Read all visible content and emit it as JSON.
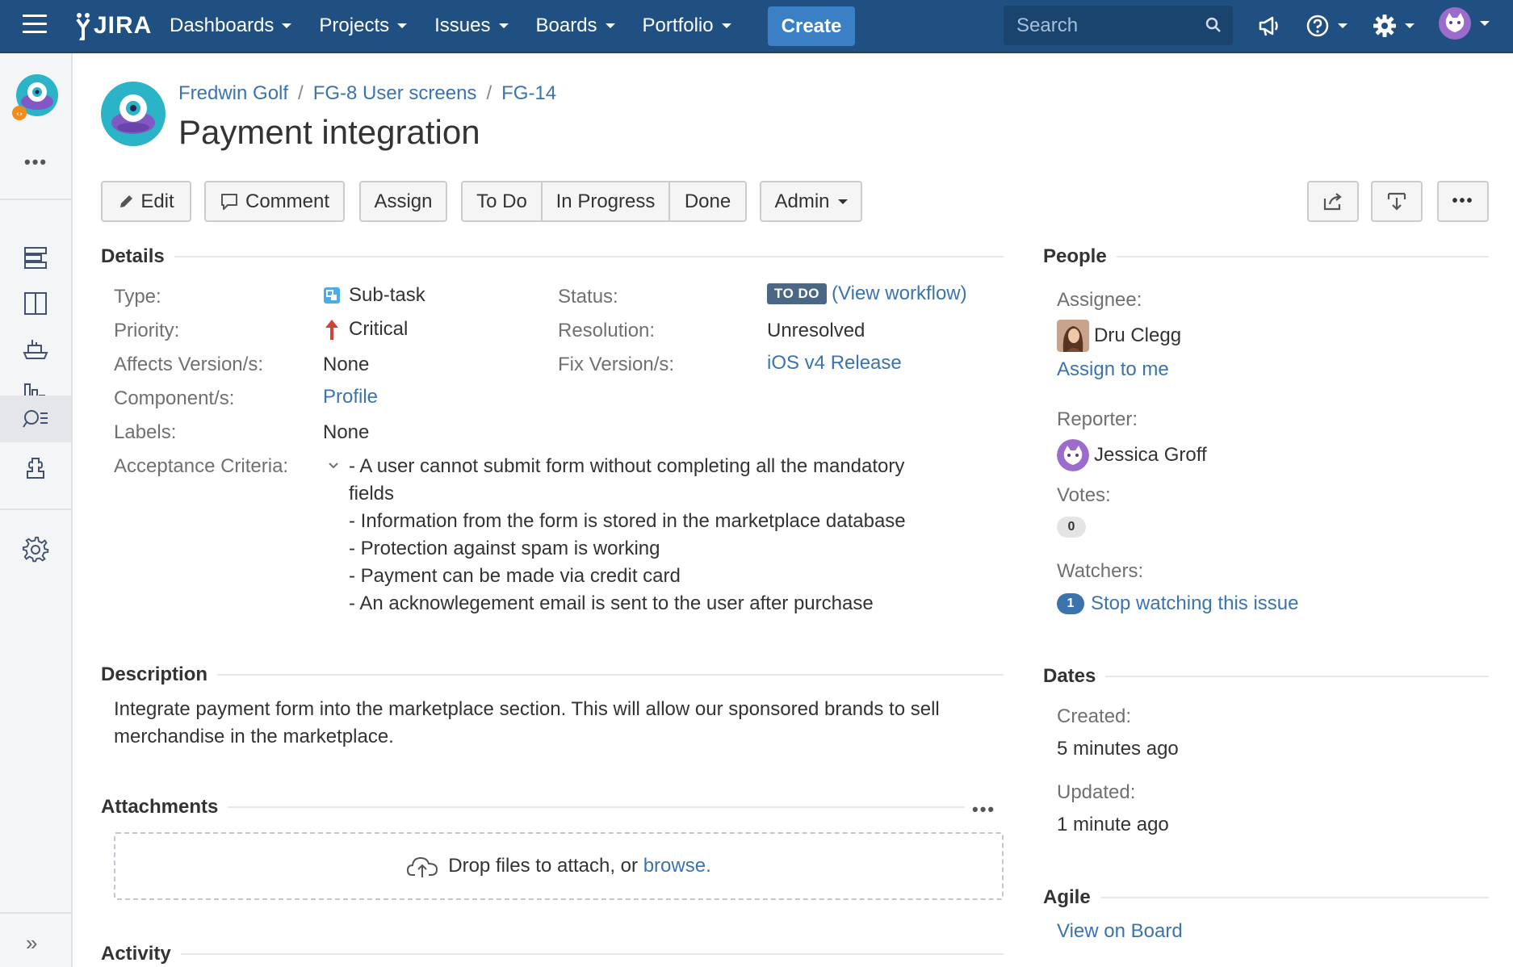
{
  "topbar": {
    "logo_text": "JIRA",
    "nav": [
      {
        "label": "Dashboards"
      },
      {
        "label": "Projects"
      },
      {
        "label": "Issues"
      },
      {
        "label": "Boards"
      },
      {
        "label": "Portfolio"
      }
    ],
    "create_label": "Create",
    "search_placeholder": "Search",
    "icons": [
      "megaphone-icon",
      "help-icon",
      "gear-icon",
      "user-avatar-icon"
    ]
  },
  "sidebar": {
    "items": [
      "backlog-icon",
      "board-icon",
      "releases-icon",
      "reports-icon",
      "issues-search-icon",
      "components-icon",
      "settings-icon"
    ],
    "active_item": "issues-search-icon"
  },
  "breadcrumb": {
    "project": "Fredwin Golf",
    "parent": "FG-8 User screens",
    "key": "FG-14"
  },
  "title": "Payment integration",
  "toolbar": {
    "edit": "Edit",
    "comment": "Comment",
    "assign": "Assign",
    "todo": "To Do",
    "inprogress": "In Progress",
    "done": "Done",
    "admin": "Admin"
  },
  "details": {
    "heading": "Details",
    "type_label": "Type:",
    "type_value": "Sub-task",
    "priority_label": "Priority:",
    "priority_value": "Critical",
    "affects_label": "Affects Version/s:",
    "affects_value": "None",
    "component_label": "Component/s:",
    "component_value": "Profile",
    "labels_label": "Labels:",
    "labels_value": "None",
    "ac_label": "Acceptance Criteria:",
    "status_label": "Status:",
    "status_value": "TO DO",
    "status_open": "(",
    "status_workflow": "View workflow",
    "status_close": ")",
    "resolution_label": "Resolution:",
    "resolution_value": "Unresolved",
    "fix_label": "Fix Version/s:",
    "fix_value": "iOS v4 Release",
    "acceptance_criteria": [
      "- A user cannot submit form without completing all the mandatory fields",
      "- Information from the form is stored in the marketplace database",
      "- Protection against spam is working",
      "- Payment can be made via credit card",
      "- An acknowlegement email is sent to the user after purchase"
    ]
  },
  "description": {
    "heading": "Description",
    "text": "Integrate payment form into the marketplace section. This will allow our sponsored brands to sell merchandise in the marketplace."
  },
  "attachments": {
    "heading": "Attachments",
    "drop_text": "Drop files to attach, or",
    "browse": "browse."
  },
  "activity": {
    "heading": "Activity"
  },
  "people": {
    "heading": "People",
    "assignee_label": "Assignee:",
    "assignee": "Dru Clegg",
    "assign_to_me": "Assign to me",
    "reporter_label": "Reporter:",
    "reporter": "Jessica Groff",
    "votes_label": "Votes:",
    "votes": "0",
    "watchers_label": "Watchers:",
    "watchers_count": "1",
    "stop_watching": "Stop watching this issue"
  },
  "dates": {
    "heading": "Dates",
    "created_label": "Created:",
    "created": "5 minutes ago",
    "updated_label": "Updated:",
    "updated": "1 minute ago"
  },
  "agile": {
    "heading": "Agile",
    "view_on_board": "View on Board"
  },
  "colors": {
    "header_bg": "#205081",
    "create_bg": "#3b7fc4",
    "link": "#3b73af",
    "lozenge": "#4a6785",
    "critical": "#d04437"
  }
}
